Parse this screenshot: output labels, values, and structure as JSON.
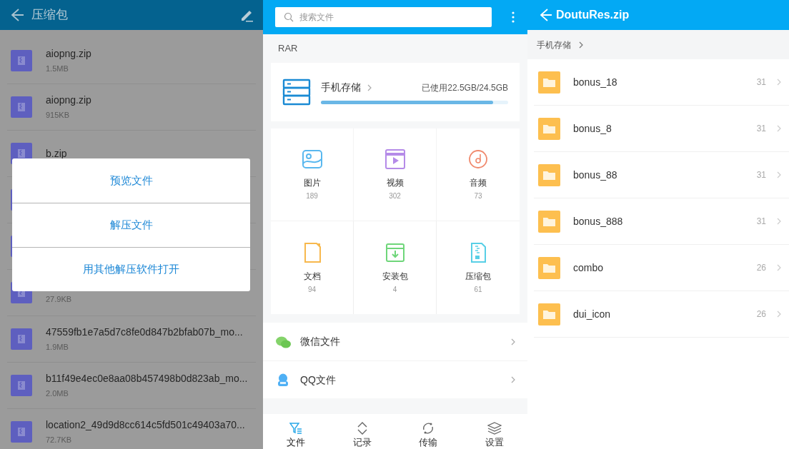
{
  "left": {
    "title": "压缩包",
    "files": [
      {
        "name": "aiopng.zip",
        "size": "1.5MB"
      },
      {
        "name": "aiopng.zip",
        "size": "915KB"
      },
      {
        "name": "b.zip"
      },
      {
        "kind": "zip"
      },
      {
        "kind": "zip"
      },
      {
        "kind": "zip",
        "size": "27.9KB"
      },
      {
        "name": "47559fb1e7a5d7c8fe0d847b2bfab07b_mo...",
        "size": "1.9MB"
      },
      {
        "name": "b11f49e4ec0e8aa08b457498b0d823ab_mo...",
        "size": "2.0MB"
      },
      {
        "name": "location2_49d9d8cc614c5fd501c49403a70...",
        "size": "72.7KB"
      }
    ],
    "dialog": [
      "预览文件",
      "解压文件",
      "用其他解压软件打开"
    ]
  },
  "middle": {
    "search": {
      "placeholder": "搜索文件"
    },
    "section": "RAR",
    "storage": {
      "label": "手机存储",
      "usage": "已使用22.5GB/24.5GB",
      "level": 0.92
    },
    "categories": [
      {
        "kind": "image",
        "label": "图片",
        "count": "189"
      },
      {
        "kind": "video",
        "label": "视频",
        "count": "302"
      },
      {
        "kind": "audio",
        "label": "音频",
        "count": "73"
      },
      {
        "kind": "document",
        "label": "文档",
        "count": "94"
      },
      {
        "kind": "package",
        "label": "安装包",
        "count": "4"
      },
      {
        "kind": "archive",
        "label": "压缩包",
        "count": "61"
      }
    ],
    "sources": [
      {
        "kind": "wechat",
        "label": "微信文件"
      },
      {
        "kind": "qq",
        "label": "QQ文件"
      }
    ],
    "nav": [
      {
        "kind": "files",
        "label": "文件",
        "selected": true
      },
      {
        "kind": "records",
        "label": "记录",
        "selected": false
      },
      {
        "kind": "transfer",
        "label": "传输",
        "selected": false
      },
      {
        "kind": "settings",
        "label": "设置",
        "selected": false
      }
    ]
  },
  "right": {
    "title": "DoutuRes.zip",
    "breadcrumb": "手机存储",
    "folders": [
      {
        "name": "bonus_18",
        "count": "31"
      },
      {
        "name": "bonus_8",
        "count": "31"
      },
      {
        "name": "bonus_88",
        "count": "31"
      },
      {
        "name": "bonus_888",
        "count": "31"
      },
      {
        "name": "combo",
        "count": "26"
      },
      {
        "name": "dui_icon",
        "count": "26"
      }
    ]
  }
}
